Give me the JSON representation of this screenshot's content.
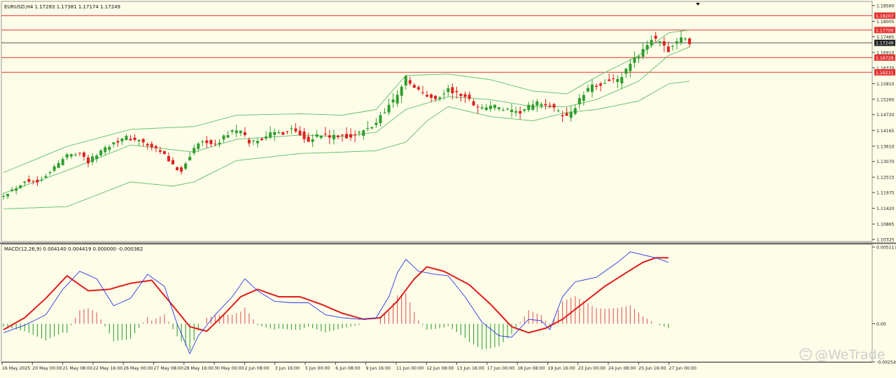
{
  "symbol_header": "EURUSD,H4  1.17283 1.17381 1.17174 1.17249",
  "macd_header": "MACD(12,26,9) 0.004140 0.004419 0.000000 -0.000362",
  "watermark": "@WeTrade",
  "colors": {
    "background": "#fdfde8",
    "bull": "#2e9e2e",
    "bear": "#e02020",
    "bollinger": "#5cbf6a",
    "level_line": "#e53030",
    "current_line": "#555555",
    "macd_line": "#2a36e8",
    "signal_line": "#e01c1c",
    "hist_pos": "#e45a5a",
    "hist_neg": "#35a235"
  },
  "chart_data": [
    {
      "type": "candlestick",
      "title": "EURUSD,H4",
      "ylim": [
        1.10325,
        1.1856
      ],
      "y_ticks": [
        "1.18560",
        "1.18005",
        "1.17465",
        "1.16910",
        "1.16370",
        "1.15810",
        "1.15260",
        "1.14720",
        "1.14165",
        "1.13610",
        "1.13070",
        "1.12515",
        "1.11975",
        "1.11420",
        "1.10865",
        "1.10325"
      ],
      "horizontal_levels": [
        {
          "label": "1.18207",
          "value": 1.18207,
          "kind": "resistance"
        },
        {
          "label": "1.17700",
          "value": 1.177,
          "kind": "resistance"
        },
        {
          "label": "1.17249",
          "value": 1.17249,
          "kind": "current"
        },
        {
          "label": "1.16729",
          "value": 1.16729,
          "kind": "support"
        },
        {
          "label": "1.16211",
          "value": 1.16211,
          "kind": "support"
        }
      ],
      "x_labels": [
        "16 May 2025",
        "20 May 00:00",
        "21 May 08:00",
        "22 May 16:00",
        "26 May 00:00",
        "27 May 08:00",
        "28 May 16:00",
        "30 May 00:00",
        "2 Jun 08:00",
        "3 Jun 16:00",
        "5 Jun 00:00",
        "6 Jun 08:00",
        "9 Jun 16:00",
        "11 Jun 00:00",
        "12 Jun 08:00",
        "13 Jun 16:00",
        "17 Jun 00:00",
        "18 Jun 08:00",
        "19 Jun 16:00",
        "23 Jun 00:00",
        "24 Jun 08:00",
        "25 Jun 16:00",
        "27 Jun 00:00"
      ],
      "close_path": [
        [
          0,
          1.119
        ],
        [
          3,
          1.1215
        ],
        [
          5,
          1.124
        ],
        [
          8,
          1.1235
        ],
        [
          10,
          1.126
        ],
        [
          13,
          1.13
        ],
        [
          15,
          1.133
        ],
        [
          18,
          1.134
        ],
        [
          20,
          1.1305
        ],
        [
          23,
          1.1345
        ],
        [
          26,
          1.1375
        ],
        [
          29,
          1.139
        ],
        [
          32,
          1.138
        ],
        [
          35,
          1.1355
        ],
        [
          38,
          1.133
        ],
        [
          40,
          1.129
        ],
        [
          42,
          1.1275
        ],
        [
          44,
          1.133
        ],
        [
          46,
          1.137
        ],
        [
          48,
          1.138
        ],
        [
          50,
          1.136
        ],
        [
          52,
          1.1395
        ],
        [
          54,
          1.1415
        ],
        [
          56,
          1.141
        ],
        [
          58,
          1.1375
        ],
        [
          60,
          1.138
        ],
        [
          62,
          1.14
        ],
        [
          64,
          1.1405
        ],
        [
          66,
          1.141
        ],
        [
          68,
          1.1425
        ],
        [
          70,
          1.1405
        ],
        [
          72,
          1.1385
        ],
        [
          74,
          1.1398
        ],
        [
          76,
          1.14
        ],
        [
          78,
          1.139
        ],
        [
          80,
          1.14
        ],
        [
          82,
          1.1395
        ],
        [
          84,
          1.1405
        ],
        [
          86,
          1.142
        ],
        [
          88,
          1.1445
        ],
        [
          90,
          1.149
        ],
        [
          92,
          1.152
        ],
        [
          94,
          1.1575
        ],
        [
          95,
          1.16
        ],
        [
          97,
          1.1565
        ],
        [
          99,
          1.1545
        ],
        [
          101,
          1.153
        ],
        [
          103,
          1.1535
        ],
        [
          105,
          1.156
        ],
        [
          107,
          1.1545
        ],
        [
          109,
          1.1535
        ],
        [
          111,
          1.151
        ],
        [
          113,
          1.1495
        ],
        [
          115,
          1.1505
        ],
        [
          117,
          1.1495
        ],
        [
          119,
          1.1485
        ],
        [
          121,
          1.1475
        ],
        [
          123,
          1.149
        ],
        [
          125,
          1.1505
        ],
        [
          127,
          1.1515
        ],
        [
          129,
          1.15
        ],
        [
          131,
          1.148
        ],
        [
          133,
          1.1465
        ],
        [
          135,
          1.15
        ],
        [
          137,
          1.1545
        ],
        [
          139,
          1.157
        ],
        [
          141,
          1.158
        ],
        [
          143,
          1.1595
        ],
        [
          145,
          1.159
        ],
        [
          147,
          1.1625
        ],
        [
          149,
          1.1665
        ],
        [
          151,
          1.1705
        ],
        [
          153,
          1.174
        ],
        [
          155,
          1.172
        ],
        [
          157,
          1.17
        ],
        [
          159,
          1.173
        ],
        [
          161,
          1.174
        ],
        [
          162,
          1.1725
        ]
      ],
      "volatility": [
        [
          0,
          0.0014
        ],
        [
          40,
          0.002
        ],
        [
          90,
          0.003
        ],
        [
          100,
          0.0026
        ],
        [
          140,
          0.0024
        ],
        [
          162,
          0.003
        ]
      ],
      "bollinger_anchors": {
        "upper": [
          [
            0,
            1.1268
          ],
          [
            15,
            1.136
          ],
          [
            30,
            1.142
          ],
          [
            45,
            1.143
          ],
          [
            55,
            1.147
          ],
          [
            70,
            1.1475
          ],
          [
            80,
            1.147
          ],
          [
            88,
            1.149
          ],
          [
            95,
            1.161
          ],
          [
            105,
            1.1615
          ],
          [
            115,
            1.1595
          ],
          [
            125,
            1.1555
          ],
          [
            133,
            1.1545
          ],
          [
            140,
            1.1605
          ],
          [
            150,
            1.168
          ],
          [
            157,
            1.176
          ],
          [
            162,
            1.177
          ]
        ],
        "middle": [
          [
            0,
            1.1195
          ],
          [
            15,
            1.1275
          ],
          [
            30,
            1.1365
          ],
          [
            45,
            1.134
          ],
          [
            55,
            1.1385
          ],
          [
            70,
            1.14
          ],
          [
            80,
            1.1395
          ],
          [
            88,
            1.141
          ],
          [
            95,
            1.149
          ],
          [
            105,
            1.1535
          ],
          [
            115,
            1.1525
          ],
          [
            125,
            1.15
          ],
          [
            133,
            1.15
          ],
          [
            140,
            1.1525
          ],
          [
            150,
            1.159
          ],
          [
            157,
            1.168
          ],
          [
            162,
            1.171
          ]
        ],
        "lower": [
          [
            0,
            1.114
          ],
          [
            15,
            1.1148
          ],
          [
            30,
            1.1235
          ],
          [
            40,
            1.122
          ],
          [
            45,
            1.1235
          ],
          [
            55,
            1.131
          ],
          [
            70,
            1.1335
          ],
          [
            80,
            1.134
          ],
          [
            88,
            1.1345
          ],
          [
            95,
            1.1375
          ],
          [
            100,
            1.145
          ],
          [
            105,
            1.15
          ],
          [
            115,
            1.1465
          ],
          [
            125,
            1.145
          ],
          [
            133,
            1.148
          ],
          [
            140,
            1.149
          ],
          [
            150,
            1.152
          ],
          [
            157,
            1.158
          ],
          [
            162,
            1.159
          ]
        ]
      }
    },
    {
      "type": "macd",
      "title": "MACD(12,26,9)",
      "ylim": [
        -0.002548,
        0.005117
      ],
      "y_ticks": [
        "0.005117",
        "0.00",
        "-0.002548"
      ],
      "macd_anchors": [
        [
          0,
          -0.0006
        ],
        [
          5,
          -0.0001
        ],
        [
          10,
          0.0006
        ],
        [
          14,
          0.0023
        ],
        [
          18,
          0.0035
        ],
        [
          22,
          0.003
        ],
        [
          26,
          0.0012
        ],
        [
          30,
          0.0017
        ],
        [
          34,
          0.0033
        ],
        [
          38,
          0.0025
        ],
        [
          41,
          0.0
        ],
        [
          44,
          -0.002
        ],
        [
          46,
          -0.0008
        ],
        [
          50,
          0.0006
        ],
        [
          54,
          0.0018
        ],
        [
          57,
          0.003
        ],
        [
          60,
          0.0022
        ],
        [
          64,
          0.0015
        ],
        [
          68,
          0.0014
        ],
        [
          72,
          0.0014
        ],
        [
          76,
          0.0006
        ],
        [
          80,
          0.0004
        ],
        [
          84,
          0.0003
        ],
        [
          88,
          0.0004
        ],
        [
          91,
          0.0018
        ],
        [
          93,
          0.0034
        ],
        [
          95,
          0.0043
        ],
        [
          98,
          0.0035
        ],
        [
          102,
          0.0033
        ],
        [
          105,
          0.0032
        ],
        [
          109,
          0.0018
        ],
        [
          113,
          0.0001
        ],
        [
          117,
          -0.0008
        ],
        [
          120,
          -0.0009
        ],
        [
          124,
          0.0003
        ],
        [
          127,
          0.0002
        ],
        [
          129,
          -0.0004
        ],
        [
          132,
          0.0018
        ],
        [
          135,
          0.0028
        ],
        [
          140,
          0.0031
        ],
        [
          145,
          0.0041
        ],
        [
          148,
          0.0048
        ],
        [
          151,
          0.0046
        ],
        [
          154,
          0.0044
        ],
        [
          157,
          0.0041
        ]
      ],
      "signal_anchors": [
        [
          0,
          -0.0004
        ],
        [
          5,
          0.0004
        ],
        [
          10,
          0.0017
        ],
        [
          15,
          0.0032
        ],
        [
          20,
          0.0022
        ],
        [
          25,
          0.0023
        ],
        [
          30,
          0.0027
        ],
        [
          35,
          0.0029
        ],
        [
          40,
          0.0012
        ],
        [
          44,
          -0.0002
        ],
        [
          48,
          -0.0005
        ],
        [
          52,
          0.0006
        ],
        [
          56,
          0.0018
        ],
        [
          60,
          0.0023
        ],
        [
          65,
          0.0018
        ],
        [
          70,
          0.0018
        ],
        [
          75,
          0.0013
        ],
        [
          80,
          0.0007
        ],
        [
          85,
          0.0003
        ],
        [
          89,
          0.0004
        ],
        [
          93,
          0.0015
        ],
        [
          97,
          0.003
        ],
        [
          100,
          0.0038
        ],
        [
          104,
          0.0035
        ],
        [
          110,
          0.0026
        ],
        [
          115,
          0.0013
        ],
        [
          120,
          -0.0002
        ],
        [
          124,
          -0.0006
        ],
        [
          128,
          -0.0003
        ],
        [
          132,
          0.0003
        ],
        [
          137,
          0.0014
        ],
        [
          142,
          0.0025
        ],
        [
          147,
          0.0034
        ],
        [
          151,
          0.0041
        ],
        [
          154,
          0.0044
        ],
        [
          157,
          0.0044
        ]
      ]
    }
  ]
}
